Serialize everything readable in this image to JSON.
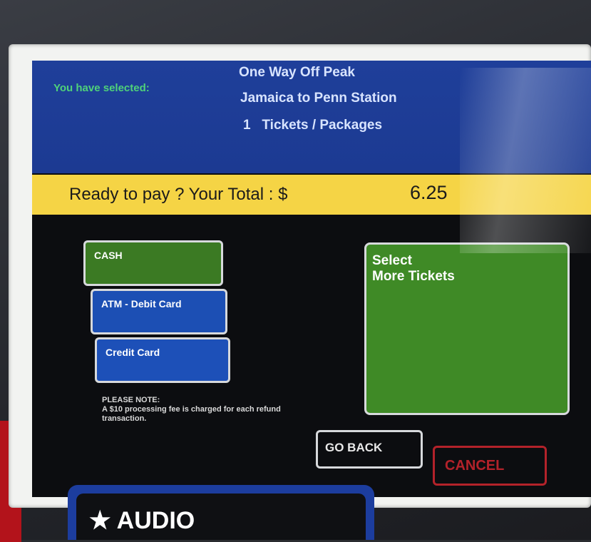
{
  "screen": {
    "selected_label": "You have selected:",
    "summary": {
      "line1": "One Way Off Peak",
      "line2": "Jamaica to Penn Station",
      "line3": "1   Tickets / Packages"
    },
    "total": {
      "label": "Ready to pay ? Your Total : $",
      "amount": "6.25"
    },
    "payment_buttons": {
      "cash": "CASH",
      "atm": "ATM - Debit Card",
      "credit": "Credit Card"
    },
    "select_more": {
      "line1": "Select",
      "line2": "More Tickets"
    },
    "note": {
      "title": "PLEASE NOTE:",
      "body": "A $10 processing fee is charged for each refund transaction."
    },
    "go_back": "GO BACK",
    "cancel": "CANCEL"
  },
  "kiosk": {
    "brand_text": "★ AUDIO"
  },
  "colors": {
    "header_blue": "#1f3f9a",
    "total_yellow": "#f5d445",
    "cash_green": "#3b7a23",
    "card_blue": "#1c4fb4",
    "cancel_red": "#b3222a"
  }
}
